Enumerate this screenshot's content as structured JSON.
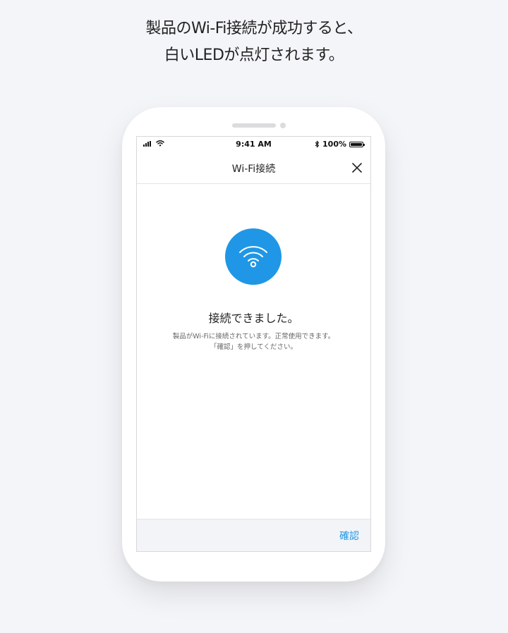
{
  "caption": {
    "line1": "製品のWi-Fi接続が成功すると、",
    "line2": "白いLEDが点灯されます。"
  },
  "status_bar": {
    "time": "9:41 AM",
    "battery": "100%"
  },
  "header": {
    "title": "Wi-Fi接続"
  },
  "main": {
    "title": "接続できました。",
    "description_line1": "製品がWi-Fiに接続されています。正常使用できます。",
    "description_line2": "「確認」を押してください。"
  },
  "footer": {
    "confirm_label": "確認"
  },
  "colors": {
    "accent": "#1f97e6",
    "background": "#f4f5f9"
  }
}
